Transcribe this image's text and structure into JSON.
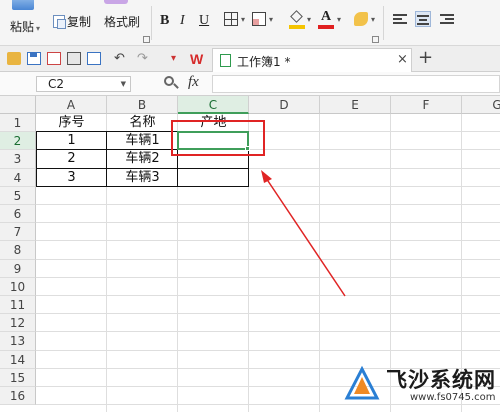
{
  "ribbon": {
    "paste_label": "粘贴",
    "copy_label": "复制",
    "format_painter_label": "格式刷",
    "bold_label": "B",
    "italic_label": "I",
    "underline_label": "U",
    "font_color_label": "A"
  },
  "quick_toolbar": {
    "app_logo": "W",
    "tab_title": "工作簿1 *",
    "close_glyph": "×",
    "new_tab_glyph": "+"
  },
  "formula_bar": {
    "name_box": "C2",
    "fx_label": "fx",
    "formula_value": ""
  },
  "sheet": {
    "columns": [
      "A",
      "B",
      "C",
      "D",
      "E",
      "F",
      "G"
    ],
    "selected_column": "C",
    "rows": [
      "1",
      "2",
      "3",
      "4",
      "5",
      "6",
      "7",
      "8",
      "9",
      "10",
      "11",
      "12",
      "13",
      "14",
      "15",
      "16"
    ],
    "selected_row": "2",
    "active_cell": "C2",
    "cells": {
      "A1": "序号",
      "B1": "名称",
      "C1": "产地",
      "A2": "1",
      "B2": "车辆1",
      "A3": "2",
      "B3": "车辆2",
      "A4": "3",
      "B4": "车辆3"
    }
  },
  "annotation": {
    "highlight_color": "#e02424",
    "arrow_color": "#e02424"
  },
  "watermark": {
    "name": "飞沙系统网",
    "url": "www.fs0745.com"
  },
  "colors": {
    "accent_green": "#3f9e5a",
    "selected_header_bg": "#dfeee3",
    "wps_red": "#d62b2b"
  }
}
